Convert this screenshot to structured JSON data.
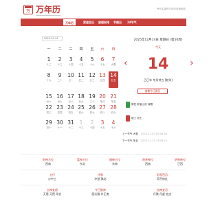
{
  "header": {
    "logo_glyph": "万",
    "brand": "万年历",
    "tagline": "专业实用的万年历查询网站"
  },
  "nav": {
    "items": [
      {
        "label": "万年历",
        "active": true
      },
      {
        "label": "黄道吉日",
        "active": false
      },
      {
        "label": "放假安排",
        "active": false
      },
      {
        "label": "节假日",
        "active": false
      },
      {
        "label": "24节气",
        "active": false
      }
    ]
  },
  "calendar": {
    "selected_date": "2025-12-14",
    "weekdays": [
      "一",
      "二",
      "三",
      "四",
      "五",
      "六",
      "日"
    ],
    "rows": [
      [
        {
          "d": "1",
          "l": "十二"
        },
        {
          "d": "2",
          "l": "十三"
        },
        {
          "d": "3",
          "l": "十四"
        },
        {
          "d": "4",
          "l": "十五"
        },
        {
          "d": "5",
          "l": "十六"
        },
        {
          "d": "6",
          "l": "十七"
        },
        {
          "d": "7",
          "l": "大雪"
        }
      ],
      [
        {
          "d": "8",
          "l": "十九"
        },
        {
          "d": "9",
          "l": "二十"
        },
        {
          "d": "10",
          "l": "廿一"
        },
        {
          "d": "11",
          "l": "廿二"
        },
        {
          "d": "12",
          "l": "廿三"
        },
        {
          "d": "13",
          "l": "廿四"
        },
        {
          "d": "14",
          "l": "廿五"
        }
      ],
      [
        {
          "d": "15",
          "l": "廿六"
        },
        {
          "d": "16",
          "l": "廿七"
        },
        {
          "d": "17",
          "l": "廿八"
        },
        {
          "d": "18",
          "l": "廿九"
        },
        {
          "d": "19",
          "l": "三十"
        },
        {
          "d": "20",
          "l": "冬月"
        },
        {
          "d": "21",
          "l": "冬至"
        }
      ],
      [
        {
          "d": "22",
          "l": "初三"
        },
        {
          "d": "23",
          "l": "初四"
        },
        {
          "d": "24",
          "l": "初五"
        },
        {
          "d": "25",
          "l": "初六"
        },
        {
          "d": "26",
          "l": "初七"
        },
        {
          "d": "27",
          "l": "初八"
        },
        {
          "d": "28",
          "l": "初九"
        }
      ],
      [
        {
          "d": "29",
          "l": "初十"
        },
        {
          "d": "30",
          "l": "十一"
        },
        {
          "d": "31",
          "l": "十二"
        },
        {
          "d": "1",
          "l": "十三"
        },
        {
          "d": "2",
          "l": "十四"
        },
        {
          "d": "3",
          "l": "十五"
        },
        {
          "d": "4",
          "l": "十六"
        }
      ]
    ]
  },
  "side": {
    "date_line": "2025年12月14日 星期日 (第50周)",
    "sub_line": "今天",
    "big_day": "14",
    "lunar_line": "乙巳年 冬月廿五 [蛇年]",
    "button": "查看今日黄历",
    "yi": {
      "label": "宜",
      "text": "祭祀 祈福 出行 嫁娶"
    },
    "ji": {
      "label": "忌",
      "text": "破土 动土"
    },
    "prev_jq": {
      "label": "上一节气",
      "name": "大雪",
      "date": "2025-12-07 00:04:54"
    },
    "next_jq": {
      "label": "下一节气",
      "name": "冬至",
      "date": "2025-12-21 23:03:13"
    }
  },
  "info": {
    "row1": [
      {
        "k": "财神方位",
        "v": "西南"
      },
      {
        "k": "喜神方位",
        "v": "东北"
      },
      {
        "k": "福神方位",
        "v": "东南"
      },
      {
        "k": "阳贵神位",
        "v": "西南"
      },
      {
        "k": "阴贵神位",
        "v": "正西"
      }
    ],
    "row2": [
      {
        "k": "五行",
        "v": "沙中土"
      },
      {
        "k": "冲煞",
        "v": "冲鼠 煞北"
      },
      {
        "k": "彭祖百忌",
        "v": "丙不修灶"
      }
    ],
    "row3": [
      {
        "k": "吉神宜趋",
        "v": "天恩 天德 母仓"
      },
      {
        "k": "今日胎神",
        "v": "厨灶碓 外正南"
      },
      {
        "k": "凶神宜忌",
        "v": "月煞 月虚 血支"
      }
    ]
  },
  "colors": {
    "accent": "#c8403c"
  }
}
